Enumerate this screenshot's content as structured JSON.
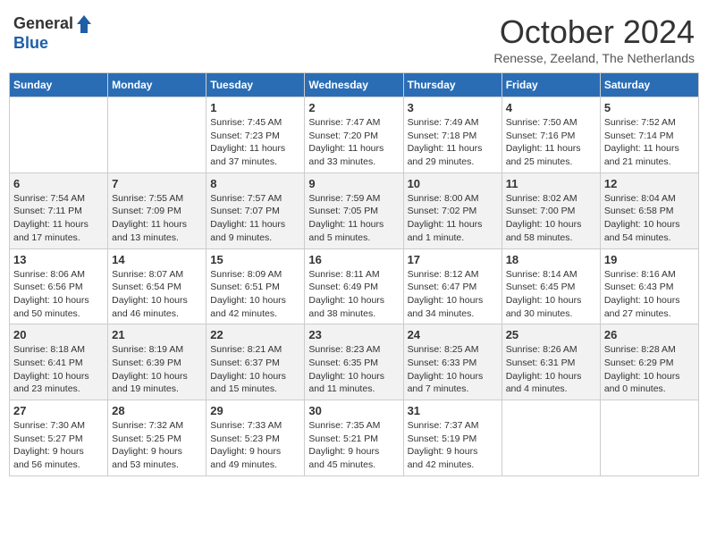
{
  "header": {
    "logo_general": "General",
    "logo_blue": "Blue",
    "month_title": "October 2024",
    "subtitle": "Renesse, Zeeland, The Netherlands"
  },
  "days_of_week": [
    "Sunday",
    "Monday",
    "Tuesday",
    "Wednesday",
    "Thursday",
    "Friday",
    "Saturday"
  ],
  "weeks": [
    [
      {
        "day": "",
        "info": ""
      },
      {
        "day": "",
        "info": ""
      },
      {
        "day": "1",
        "info": "Sunrise: 7:45 AM\nSunset: 7:23 PM\nDaylight: 11 hours\nand 37 minutes."
      },
      {
        "day": "2",
        "info": "Sunrise: 7:47 AM\nSunset: 7:20 PM\nDaylight: 11 hours\nand 33 minutes."
      },
      {
        "day": "3",
        "info": "Sunrise: 7:49 AM\nSunset: 7:18 PM\nDaylight: 11 hours\nand 29 minutes."
      },
      {
        "day": "4",
        "info": "Sunrise: 7:50 AM\nSunset: 7:16 PM\nDaylight: 11 hours\nand 25 minutes."
      },
      {
        "day": "5",
        "info": "Sunrise: 7:52 AM\nSunset: 7:14 PM\nDaylight: 11 hours\nand 21 minutes."
      }
    ],
    [
      {
        "day": "6",
        "info": "Sunrise: 7:54 AM\nSunset: 7:11 PM\nDaylight: 11 hours\nand 17 minutes."
      },
      {
        "day": "7",
        "info": "Sunrise: 7:55 AM\nSunset: 7:09 PM\nDaylight: 11 hours\nand 13 minutes."
      },
      {
        "day": "8",
        "info": "Sunrise: 7:57 AM\nSunset: 7:07 PM\nDaylight: 11 hours\nand 9 minutes."
      },
      {
        "day": "9",
        "info": "Sunrise: 7:59 AM\nSunset: 7:05 PM\nDaylight: 11 hours\nand 5 minutes."
      },
      {
        "day": "10",
        "info": "Sunrise: 8:00 AM\nSunset: 7:02 PM\nDaylight: 11 hours\nand 1 minute."
      },
      {
        "day": "11",
        "info": "Sunrise: 8:02 AM\nSunset: 7:00 PM\nDaylight: 10 hours\nand 58 minutes."
      },
      {
        "day": "12",
        "info": "Sunrise: 8:04 AM\nSunset: 6:58 PM\nDaylight: 10 hours\nand 54 minutes."
      }
    ],
    [
      {
        "day": "13",
        "info": "Sunrise: 8:06 AM\nSunset: 6:56 PM\nDaylight: 10 hours\nand 50 minutes."
      },
      {
        "day": "14",
        "info": "Sunrise: 8:07 AM\nSunset: 6:54 PM\nDaylight: 10 hours\nand 46 minutes."
      },
      {
        "day": "15",
        "info": "Sunrise: 8:09 AM\nSunset: 6:51 PM\nDaylight: 10 hours\nand 42 minutes."
      },
      {
        "day": "16",
        "info": "Sunrise: 8:11 AM\nSunset: 6:49 PM\nDaylight: 10 hours\nand 38 minutes."
      },
      {
        "day": "17",
        "info": "Sunrise: 8:12 AM\nSunset: 6:47 PM\nDaylight: 10 hours\nand 34 minutes."
      },
      {
        "day": "18",
        "info": "Sunrise: 8:14 AM\nSunset: 6:45 PM\nDaylight: 10 hours\nand 30 minutes."
      },
      {
        "day": "19",
        "info": "Sunrise: 8:16 AM\nSunset: 6:43 PM\nDaylight: 10 hours\nand 27 minutes."
      }
    ],
    [
      {
        "day": "20",
        "info": "Sunrise: 8:18 AM\nSunset: 6:41 PM\nDaylight: 10 hours\nand 23 minutes."
      },
      {
        "day": "21",
        "info": "Sunrise: 8:19 AM\nSunset: 6:39 PM\nDaylight: 10 hours\nand 19 minutes."
      },
      {
        "day": "22",
        "info": "Sunrise: 8:21 AM\nSunset: 6:37 PM\nDaylight: 10 hours\nand 15 minutes."
      },
      {
        "day": "23",
        "info": "Sunrise: 8:23 AM\nSunset: 6:35 PM\nDaylight: 10 hours\nand 11 minutes."
      },
      {
        "day": "24",
        "info": "Sunrise: 8:25 AM\nSunset: 6:33 PM\nDaylight: 10 hours\nand 7 minutes."
      },
      {
        "day": "25",
        "info": "Sunrise: 8:26 AM\nSunset: 6:31 PM\nDaylight: 10 hours\nand 4 minutes."
      },
      {
        "day": "26",
        "info": "Sunrise: 8:28 AM\nSunset: 6:29 PM\nDaylight: 10 hours\nand 0 minutes."
      }
    ],
    [
      {
        "day": "27",
        "info": "Sunrise: 7:30 AM\nSunset: 5:27 PM\nDaylight: 9 hours\nand 56 minutes."
      },
      {
        "day": "28",
        "info": "Sunrise: 7:32 AM\nSunset: 5:25 PM\nDaylight: 9 hours\nand 53 minutes."
      },
      {
        "day": "29",
        "info": "Sunrise: 7:33 AM\nSunset: 5:23 PM\nDaylight: 9 hours\nand 49 minutes."
      },
      {
        "day": "30",
        "info": "Sunrise: 7:35 AM\nSunset: 5:21 PM\nDaylight: 9 hours\nand 45 minutes."
      },
      {
        "day": "31",
        "info": "Sunrise: 7:37 AM\nSunset: 5:19 PM\nDaylight: 9 hours\nand 42 minutes."
      },
      {
        "day": "",
        "info": ""
      },
      {
        "day": "",
        "info": ""
      }
    ]
  ]
}
